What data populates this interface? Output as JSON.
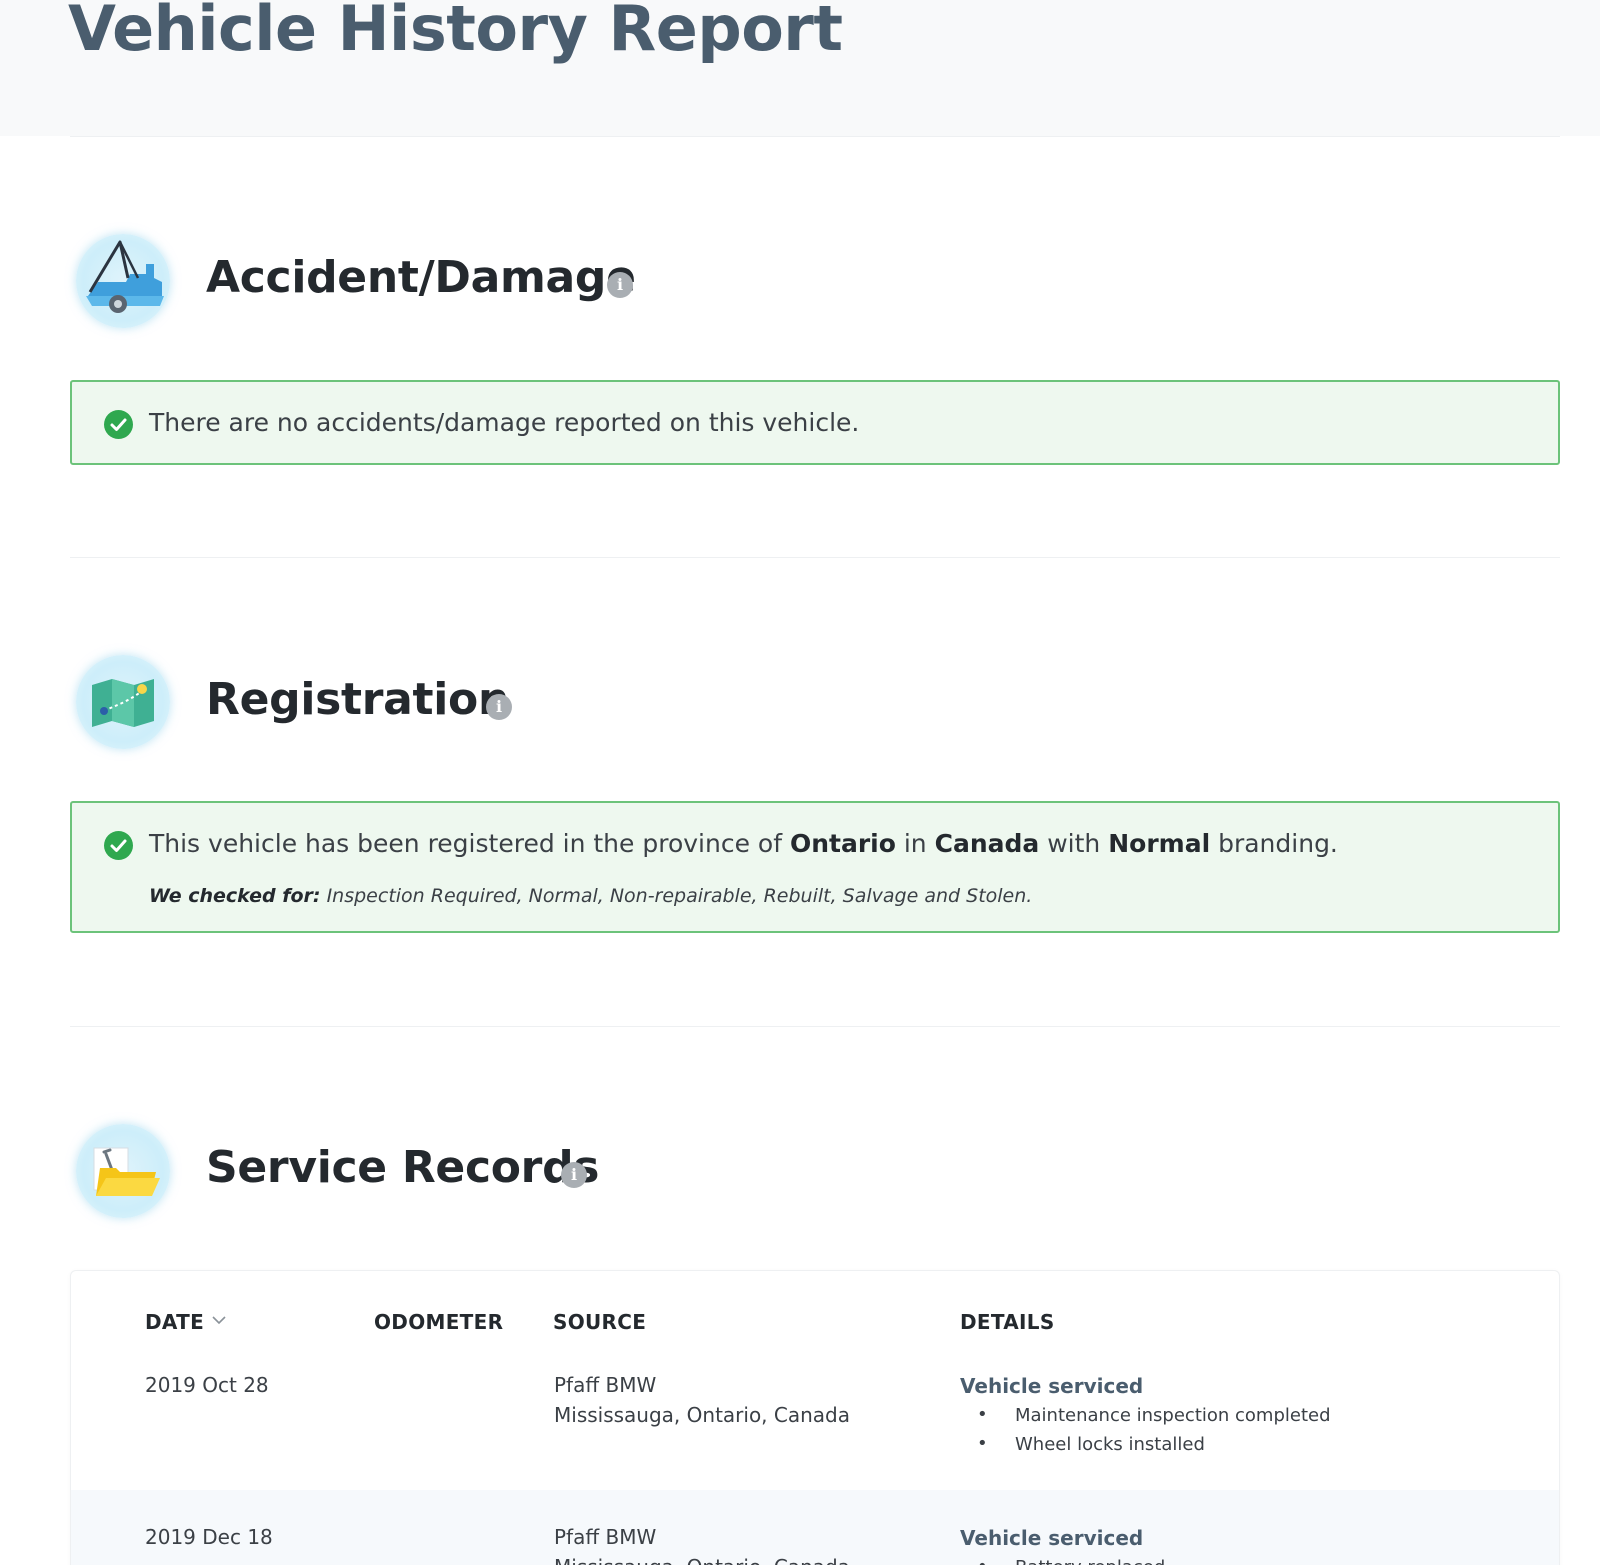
{
  "page": {
    "title": "Vehicle History Report"
  },
  "accident": {
    "title": "Accident/Damage",
    "icon": "tow-truck-icon",
    "status": "There are no accidents/damage reported on this vehicle."
  },
  "registration": {
    "title": "Registration",
    "icon": "map-icon",
    "status_prefix": "This vehicle has been registered in the province of",
    "province": "Ontario",
    "in_word": "in",
    "country": "Canada",
    "with_word": "with",
    "branding": "Normal",
    "status_suffix": "branding.",
    "checked_label": "We checked for:",
    "checked_list": "Inspection Required, Normal, Non-repairable, Rebuilt, Salvage and Stolen."
  },
  "service": {
    "title": "Service Records",
    "icon": "folder-wrench-icon",
    "columns": {
      "date": "DATE",
      "odometer": "ODOMETER",
      "source": "SOURCE",
      "details": "DETAILS"
    },
    "rows": [
      {
        "date": "2019 Oct 28",
        "odometer": "",
        "source_name": "Pfaff BMW",
        "source_location": "Mississauga, Ontario, Canada",
        "detail_title": "Vehicle serviced",
        "detail_items": [
          "Maintenance inspection completed",
          "Wheel locks installed"
        ]
      },
      {
        "date": "2019 Dec 18",
        "odometer": "",
        "source_name": "Pfaff BMW",
        "source_location": "Mississauga, Ontario, Canada",
        "detail_title": "Vehicle serviced",
        "detail_items": [
          "Battery replaced"
        ]
      }
    ]
  },
  "colors": {
    "title": "#4a5d6e",
    "success_border": "#6cc37a",
    "success_bg": "#eef8ef",
    "check": "#2fa84f"
  }
}
